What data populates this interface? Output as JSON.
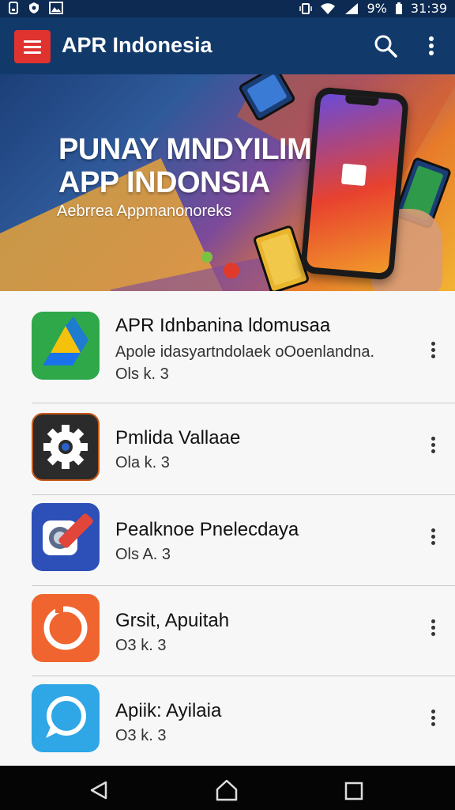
{
  "status_bar": {
    "battery_percent": "9%",
    "time": "31:39"
  },
  "app_bar": {
    "title": "APR Indonesia"
  },
  "banner": {
    "title_line1": "PUNAY MNDYILIM",
    "title_line2": "APP INDONSIA",
    "subtitle": "Aebrrea Appmanonoreks"
  },
  "apps": [
    {
      "title": "APR Idnbanina ldomusaa",
      "description": "Apole idasyartndolaek oOoenlandna.",
      "rating": "Ols k. 3"
    },
    {
      "title": "Pmlida Vallaae",
      "description": "",
      "rating": "Ola k. 3"
    },
    {
      "title": "Pealknoe Pnelecdaya",
      "description": "",
      "rating": "Ols A. 3"
    },
    {
      "title": "Grsit, Apuitah",
      "description": "",
      "rating": "O3 k. 3"
    },
    {
      "title": "Apiik: Ayilaia",
      "description": "",
      "rating": "O3 k. 3"
    }
  ],
  "colors": {
    "app_bar": "#113a6b",
    "menu_button": "#e0322f",
    "status_bar": "#0c2a52"
  }
}
